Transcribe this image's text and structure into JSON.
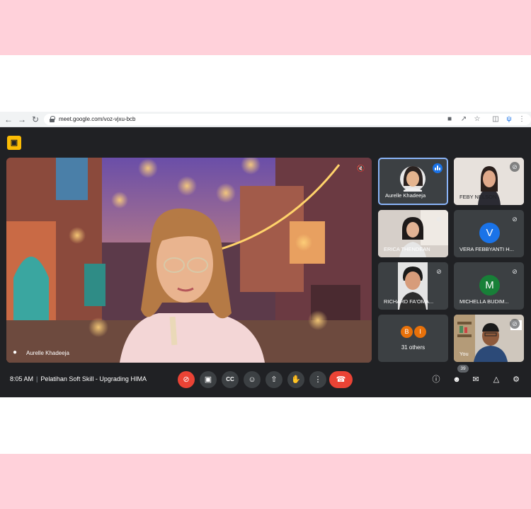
{
  "browser": {
    "url": "meet.google.com/voz-vjxu-bcb",
    "icons": [
      "back-icon",
      "forward-icon",
      "reload-icon",
      "lock-icon",
      "camera-icon",
      "share-icon",
      "star-icon",
      "sidebar-icon",
      "extension-icon",
      "menu-icon"
    ]
  },
  "meet": {
    "main_speaker": {
      "name": "Aurelle Khadeeja"
    },
    "tiles": [
      {
        "name": "Aurelle Khadeeja",
        "active": true,
        "speaking": true
      },
      {
        "name": "FEBY NELSON",
        "muted": true
      },
      {
        "name": "ERICA THENDEAN",
        "muted": true
      },
      {
        "name": "VERA FEBBYANTI H...",
        "initial": "V",
        "muted": true
      },
      {
        "name": "RICHARD FA'OMA...",
        "muted": true
      },
      {
        "name": "MICHELLA BUDIM...",
        "initial": "M",
        "muted": true
      },
      {
        "others_label": "31 others",
        "initials": [
          "B",
          "I"
        ]
      },
      {
        "name": "You",
        "muted": true
      }
    ],
    "bottom": {
      "time": "8:05 AM",
      "meeting_title": "Pelatihan Soft Skill - Upgrading HIMA",
      "participant_count": "39"
    }
  },
  "colors": {
    "accent_blue": "#8ab4f8",
    "mic_off_red": "#ea4335",
    "avatar_v": "#1a73e8",
    "avatar_m": "#188038",
    "avatar_b": "#e8710a",
    "avatar_i": "#e8710a",
    "cam_off_yellow": "#fbbc04"
  }
}
